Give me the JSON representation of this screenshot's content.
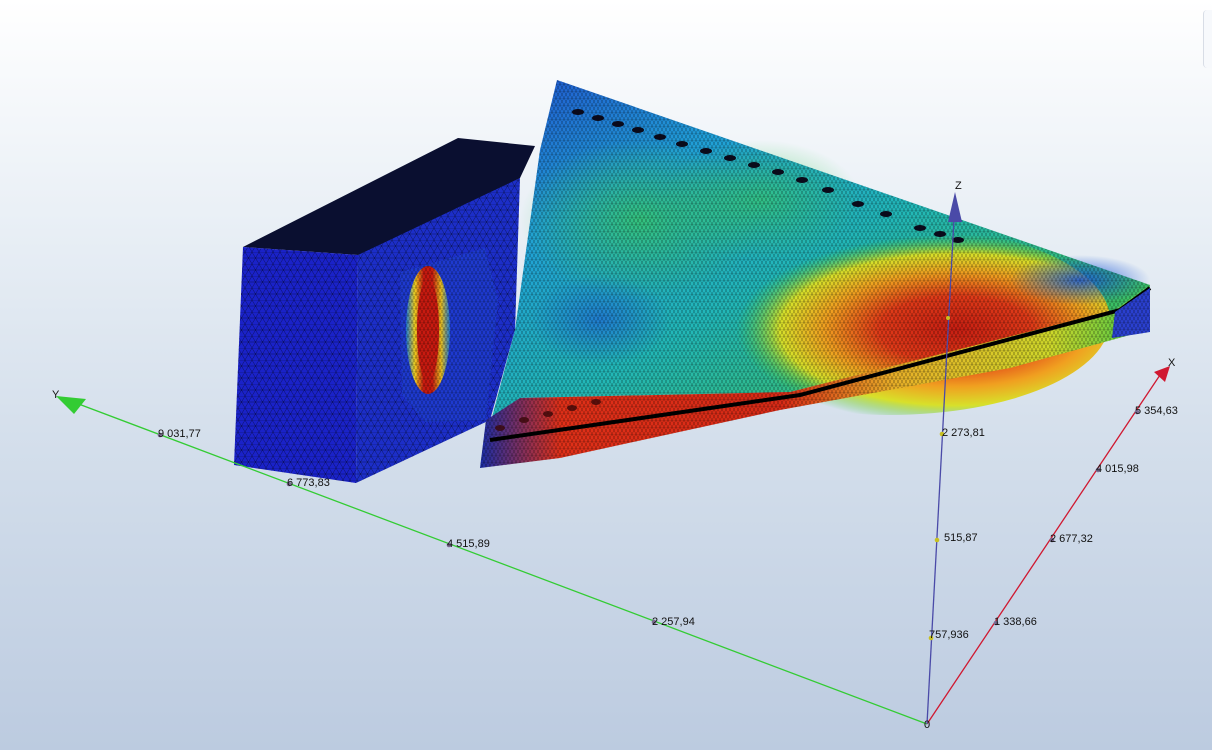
{
  "axes": {
    "x": {
      "name": "X",
      "color": "#d01830",
      "ticks": [
        "1 338,66",
        "2 677,32",
        "4 015,98",
        "5 354,63"
      ]
    },
    "y": {
      "name": "Y",
      "color": "#33cc33",
      "ticks": [
        "2 257,94",
        "4 515,89",
        "6 773,83",
        "9 031,77"
      ]
    },
    "z": {
      "name": "Z",
      "color": "#4a4aa8",
      "ticks": [
        "757,936",
        "515,87",
        "2 273,81"
      ]
    },
    "origin_label": "0"
  },
  "model": {
    "description_colors": {
      "low": "#1a22c8",
      "mid_low": "#1ea8d8",
      "mid": "#3cc84a",
      "mid_high": "#e8d82a",
      "high": "#d42418",
      "mesh": "#000000"
    }
  }
}
